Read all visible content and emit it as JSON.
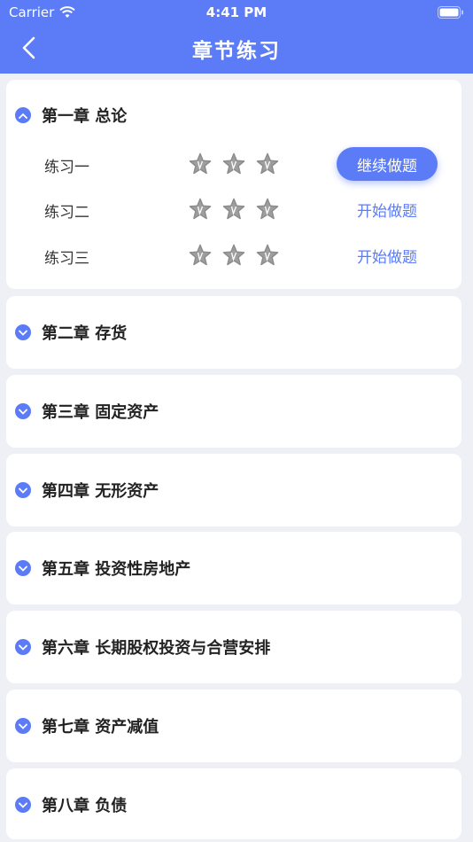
{
  "status_bar": {
    "carrier": "Carrier",
    "time": "4:41 PM"
  },
  "nav": {
    "title": "章节练习"
  },
  "chapters": [
    {
      "title": "第一章 总论",
      "expanded": true,
      "exercises": [
        {
          "label": "练习一",
          "action": "继续做题",
          "primary": true,
          "stars": 3
        },
        {
          "label": "练习二",
          "action": "开始做题",
          "primary": false,
          "stars": 3
        },
        {
          "label": "练习三",
          "action": "开始做题",
          "primary": false,
          "stars": 3
        }
      ]
    },
    {
      "title": "第二章 存货",
      "expanded": false
    },
    {
      "title": "第三章 固定资产",
      "expanded": false
    },
    {
      "title": "第四章 无形资产",
      "expanded": false
    },
    {
      "title": "第五章 投资性房地产",
      "expanded": false
    },
    {
      "title": "第六章 长期股权投资与合营安排",
      "expanded": false
    },
    {
      "title": "第七章 资产减值",
      "expanded": false
    },
    {
      "title": "第八章 负债",
      "expanded": false
    }
  ],
  "colors": {
    "accent": "#5b7cf6",
    "star": "#9e9e9e",
    "background": "#eef0f5"
  }
}
